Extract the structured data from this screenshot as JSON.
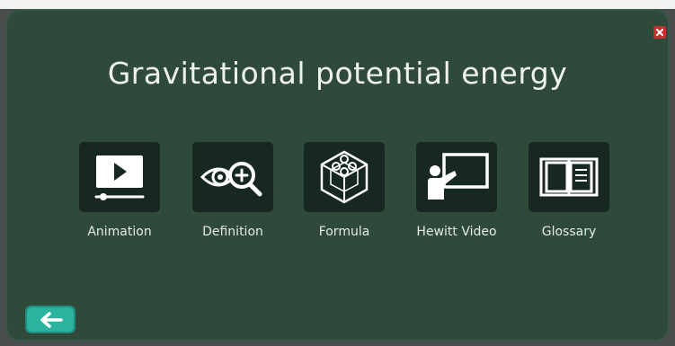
{
  "screen": {
    "title": "Gravitational potential energy"
  },
  "menu": {
    "items": [
      {
        "label": "Animation",
        "icon": "video-play-icon"
      },
      {
        "label": "Definition",
        "icon": "eye-magnifier-icon"
      },
      {
        "label": "Formula",
        "icon": "molecule-cube-icon"
      },
      {
        "label": "Hewitt Video",
        "icon": "presenter-board-icon"
      },
      {
        "label": "Glossary",
        "icon": "open-book-icon"
      }
    ]
  },
  "controls": {
    "close_icon": "close-icon",
    "back_icon": "back-arrow-icon"
  },
  "colors": {
    "board": "#2f4a3b",
    "tile": "#172823",
    "back_button": "#2bb3a0",
    "close_button": "#c0342c"
  }
}
